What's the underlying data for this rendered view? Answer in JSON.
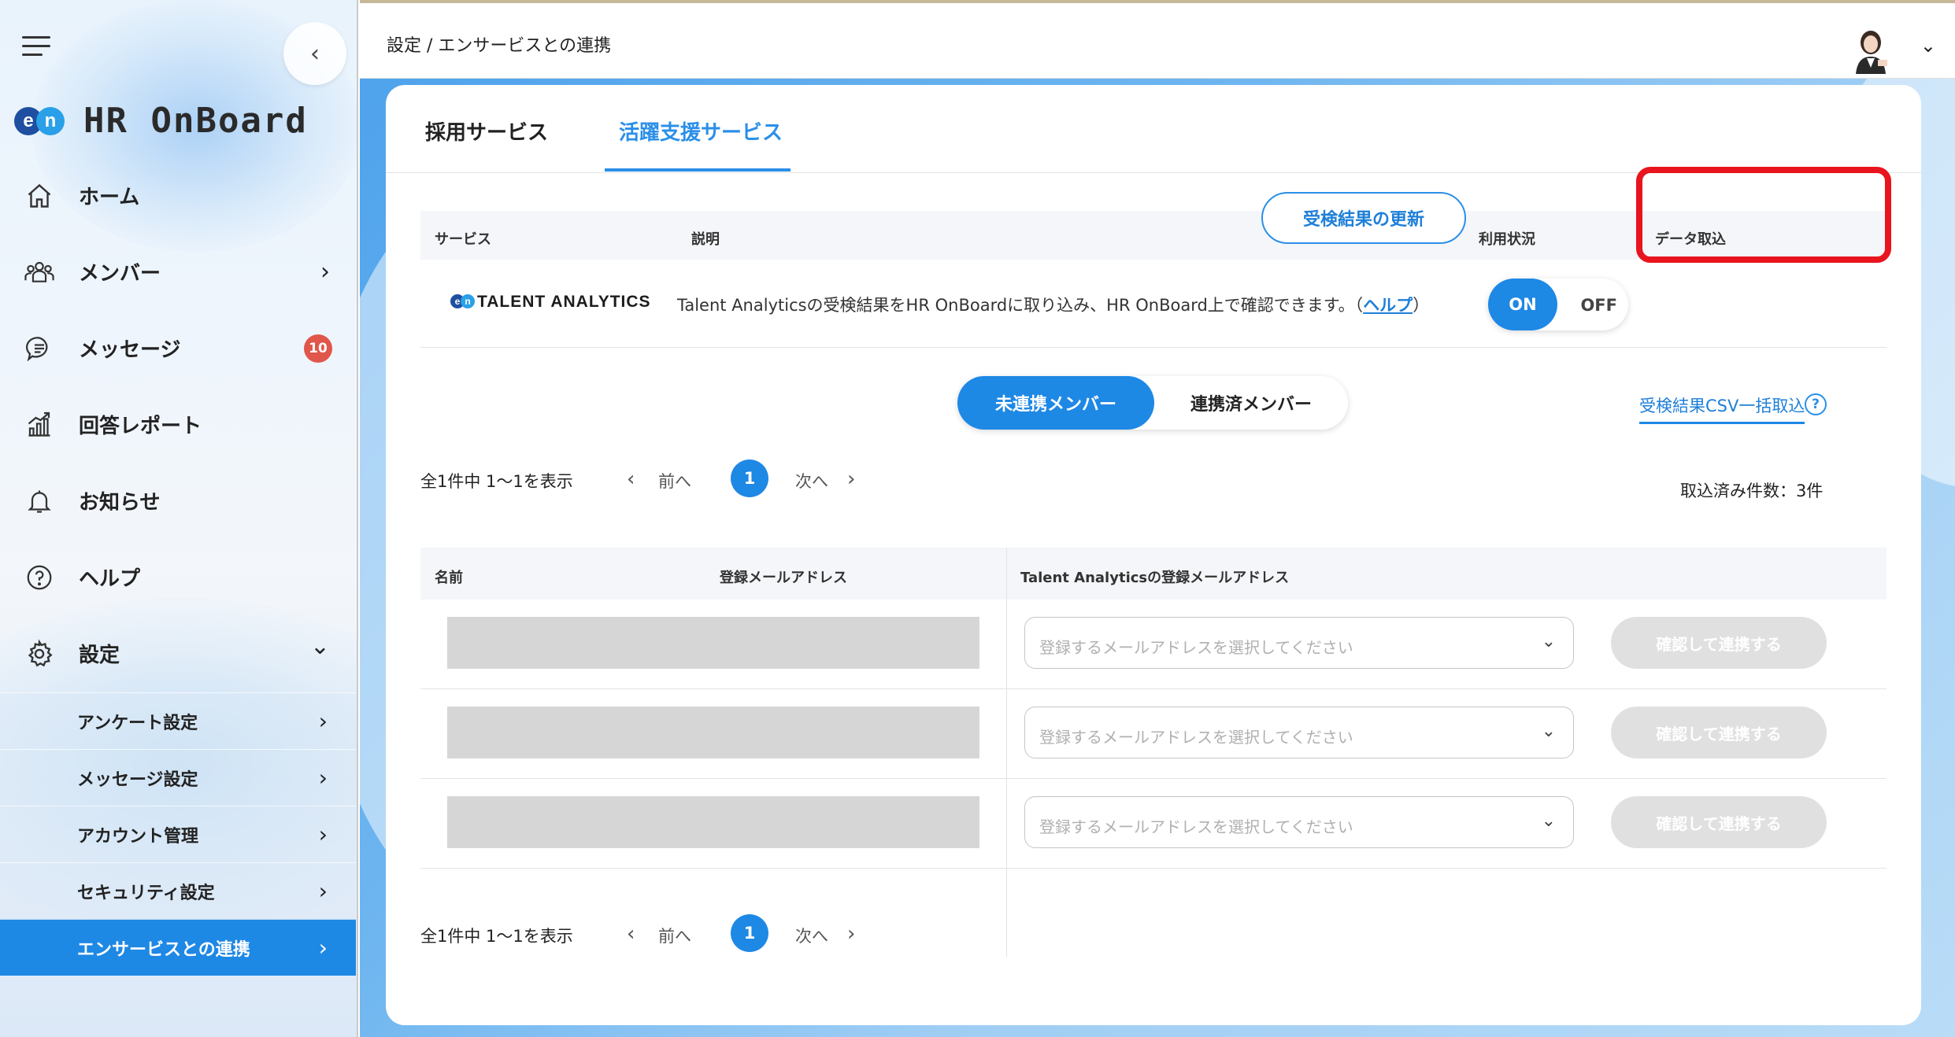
{
  "sidebar": {
    "logo_mark": "en",
    "logo_text": "HR OnBoard",
    "collapse_glyph": "‹",
    "items": [
      {
        "label": "ホーム",
        "icon": "home-icon"
      },
      {
        "label": "メンバー",
        "icon": "members-icon",
        "chevron": "›"
      },
      {
        "label": "メッセージ",
        "icon": "message-icon",
        "badge": "10"
      },
      {
        "label": "回答レポート",
        "icon": "report-icon"
      },
      {
        "label": "お知らせ",
        "icon": "bell-icon"
      },
      {
        "label": "ヘルプ",
        "icon": "help-icon"
      },
      {
        "label": "設定",
        "icon": "gear-icon",
        "chevron": "⌄"
      }
    ],
    "sub_items": [
      {
        "label": "アンケート設定"
      },
      {
        "label": "メッセージ設定"
      },
      {
        "label": "アカウント管理"
      },
      {
        "label": "セキュリティ設定"
      },
      {
        "label": "エンサービスとの連携",
        "active": true
      }
    ],
    "chevron_right": "›",
    "accent": "#1e88e5"
  },
  "header": {
    "breadcrumb": "設定 / エンサービスとの連携",
    "avatar_chevron": "⌄"
  },
  "tabs": {
    "items": [
      "採用サービス",
      "活躍支援サービス"
    ],
    "active_index": 1
  },
  "service_table": {
    "headers": {
      "service": "サービス",
      "description": "説明",
      "status": "利用状況",
      "import": "データ取込"
    },
    "row": {
      "logo_mark": [
        "e",
        "n"
      ],
      "logo_text": "TALENT ANALYTICS",
      "description": "Talent Analyticsの受検結果をHR OnBoardに取り込み、HR OnBoard上で確認できます。（",
      "help_link": "ヘルプ",
      "description_end": "）",
      "toggle_on": "ON",
      "toggle_off": "OFF",
      "update_button": "受検結果の更新"
    },
    "highlight_color": "#e8141e"
  },
  "segments": {
    "items": [
      "未連携メンバー",
      "連携済メンバー"
    ],
    "active_index": 0
  },
  "csv_link": "受検結果CSV一括取込",
  "csv_help": "?",
  "pager_top": {
    "count": "全1件中 1〜1を表示",
    "prev": "前へ",
    "page": "1",
    "next": "次へ",
    "prev_icon": "‹",
    "next_icon": "›"
  },
  "pager_bottom": {
    "count": "全1件中 1〜1を表示",
    "prev": "前へ",
    "page": "1",
    "next": "次へ",
    "prev_icon": "‹",
    "next_icon": "›"
  },
  "imported_count": "取込済み件数：3件",
  "member_table": {
    "headers": {
      "name": "名前",
      "email": "登録メールアドレス",
      "ta_email": "Talent Analyticsの登録メールアドレス"
    },
    "rows": [
      {
        "select_placeholder": "登録するメールアドレスを選択してください",
        "confirm_label": "確認して連携する"
      },
      {
        "select_placeholder": "登録するメールアドレスを選択してください",
        "confirm_label": "確認して連携する"
      },
      {
        "select_placeholder": "登録するメールアドレスを選択してください",
        "confirm_label": "確認して連携する"
      }
    ],
    "arrow_glyph": "⌄"
  }
}
